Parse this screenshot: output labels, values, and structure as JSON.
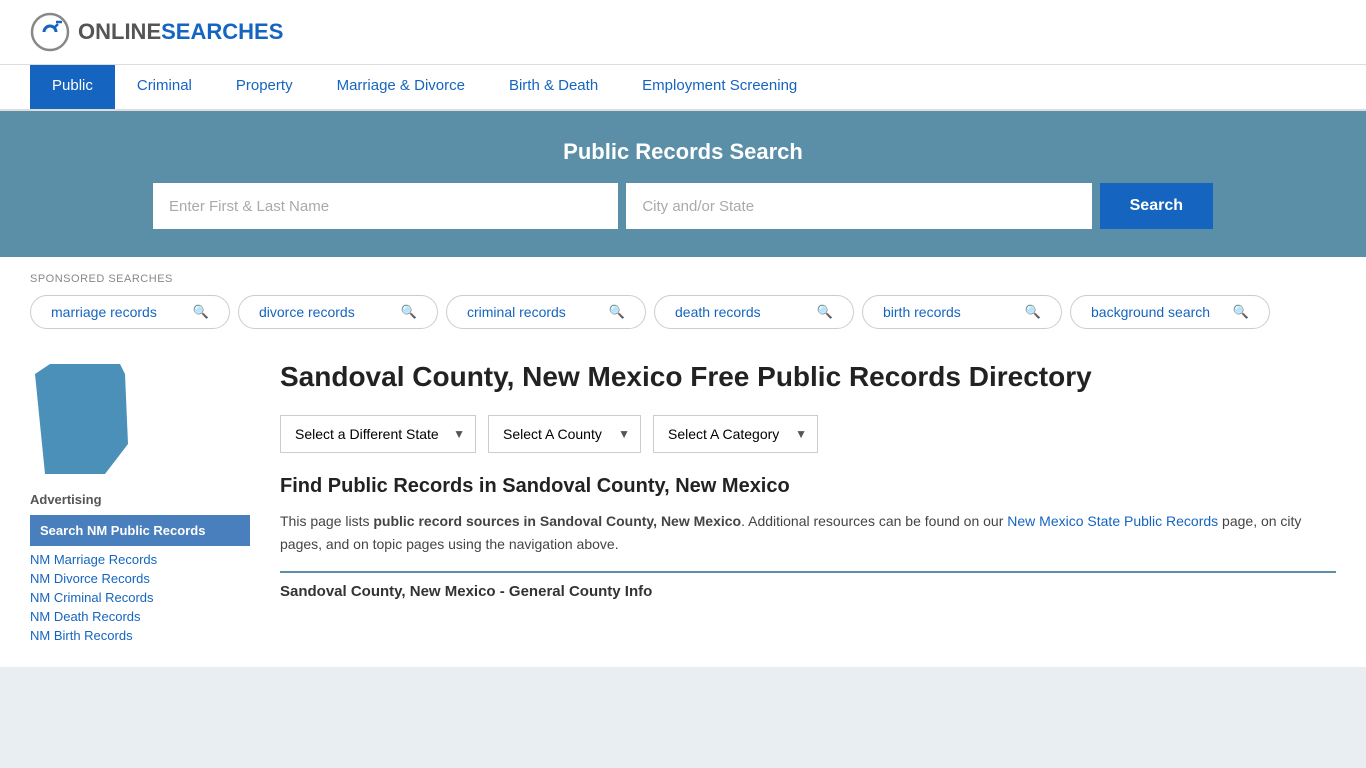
{
  "header": {
    "logo_online": "ONLINE",
    "logo_searches": "SEARCHES",
    "logo_alt": "OnlineSearches logo"
  },
  "nav": {
    "items": [
      {
        "label": "Public",
        "active": true
      },
      {
        "label": "Criminal",
        "active": false
      },
      {
        "label": "Property",
        "active": false
      },
      {
        "label": "Marriage & Divorce",
        "active": false
      },
      {
        "label": "Birth & Death",
        "active": false
      },
      {
        "label": "Employment Screening",
        "active": false
      }
    ]
  },
  "search_banner": {
    "title": "Public Records Search",
    "name_placeholder": "Enter First & Last Name",
    "location_placeholder": "City and/or State",
    "button_label": "Search"
  },
  "sponsored": {
    "label": "SPONSORED SEARCHES",
    "pills": [
      {
        "label": "marriage records"
      },
      {
        "label": "divorce records"
      },
      {
        "label": "criminal records"
      },
      {
        "label": "death records"
      },
      {
        "label": "birth records"
      },
      {
        "label": "background search"
      }
    ]
  },
  "sidebar": {
    "advertising_label": "Advertising",
    "ad_box_label": "Search NM Public Records",
    "links": [
      {
        "label": "NM Marriage Records"
      },
      {
        "label": "NM Divorce Records"
      },
      {
        "label": "NM Criminal Records"
      },
      {
        "label": "NM Death Records"
      },
      {
        "label": "NM Birth Records"
      }
    ]
  },
  "main": {
    "page_title": "Sandoval County, New Mexico Free Public Records Directory",
    "dropdowns": {
      "state": {
        "placeholder": "Select a Different State"
      },
      "county": {
        "placeholder": "Select A County"
      },
      "category": {
        "placeholder": "Select A Category"
      }
    },
    "find_title": "Find Public Records in Sandoval County, New Mexico",
    "find_desc_part1": "This page lists ",
    "find_desc_bold": "public record sources in Sandoval County, New Mexico",
    "find_desc_part2": ". Additional resources can be found on our ",
    "find_desc_link": "New Mexico State Public Records",
    "find_desc_part3": " page, on city pages, and on topic pages using the navigation above.",
    "general_info_label": "Sandoval County, New Mexico - General County Info"
  }
}
